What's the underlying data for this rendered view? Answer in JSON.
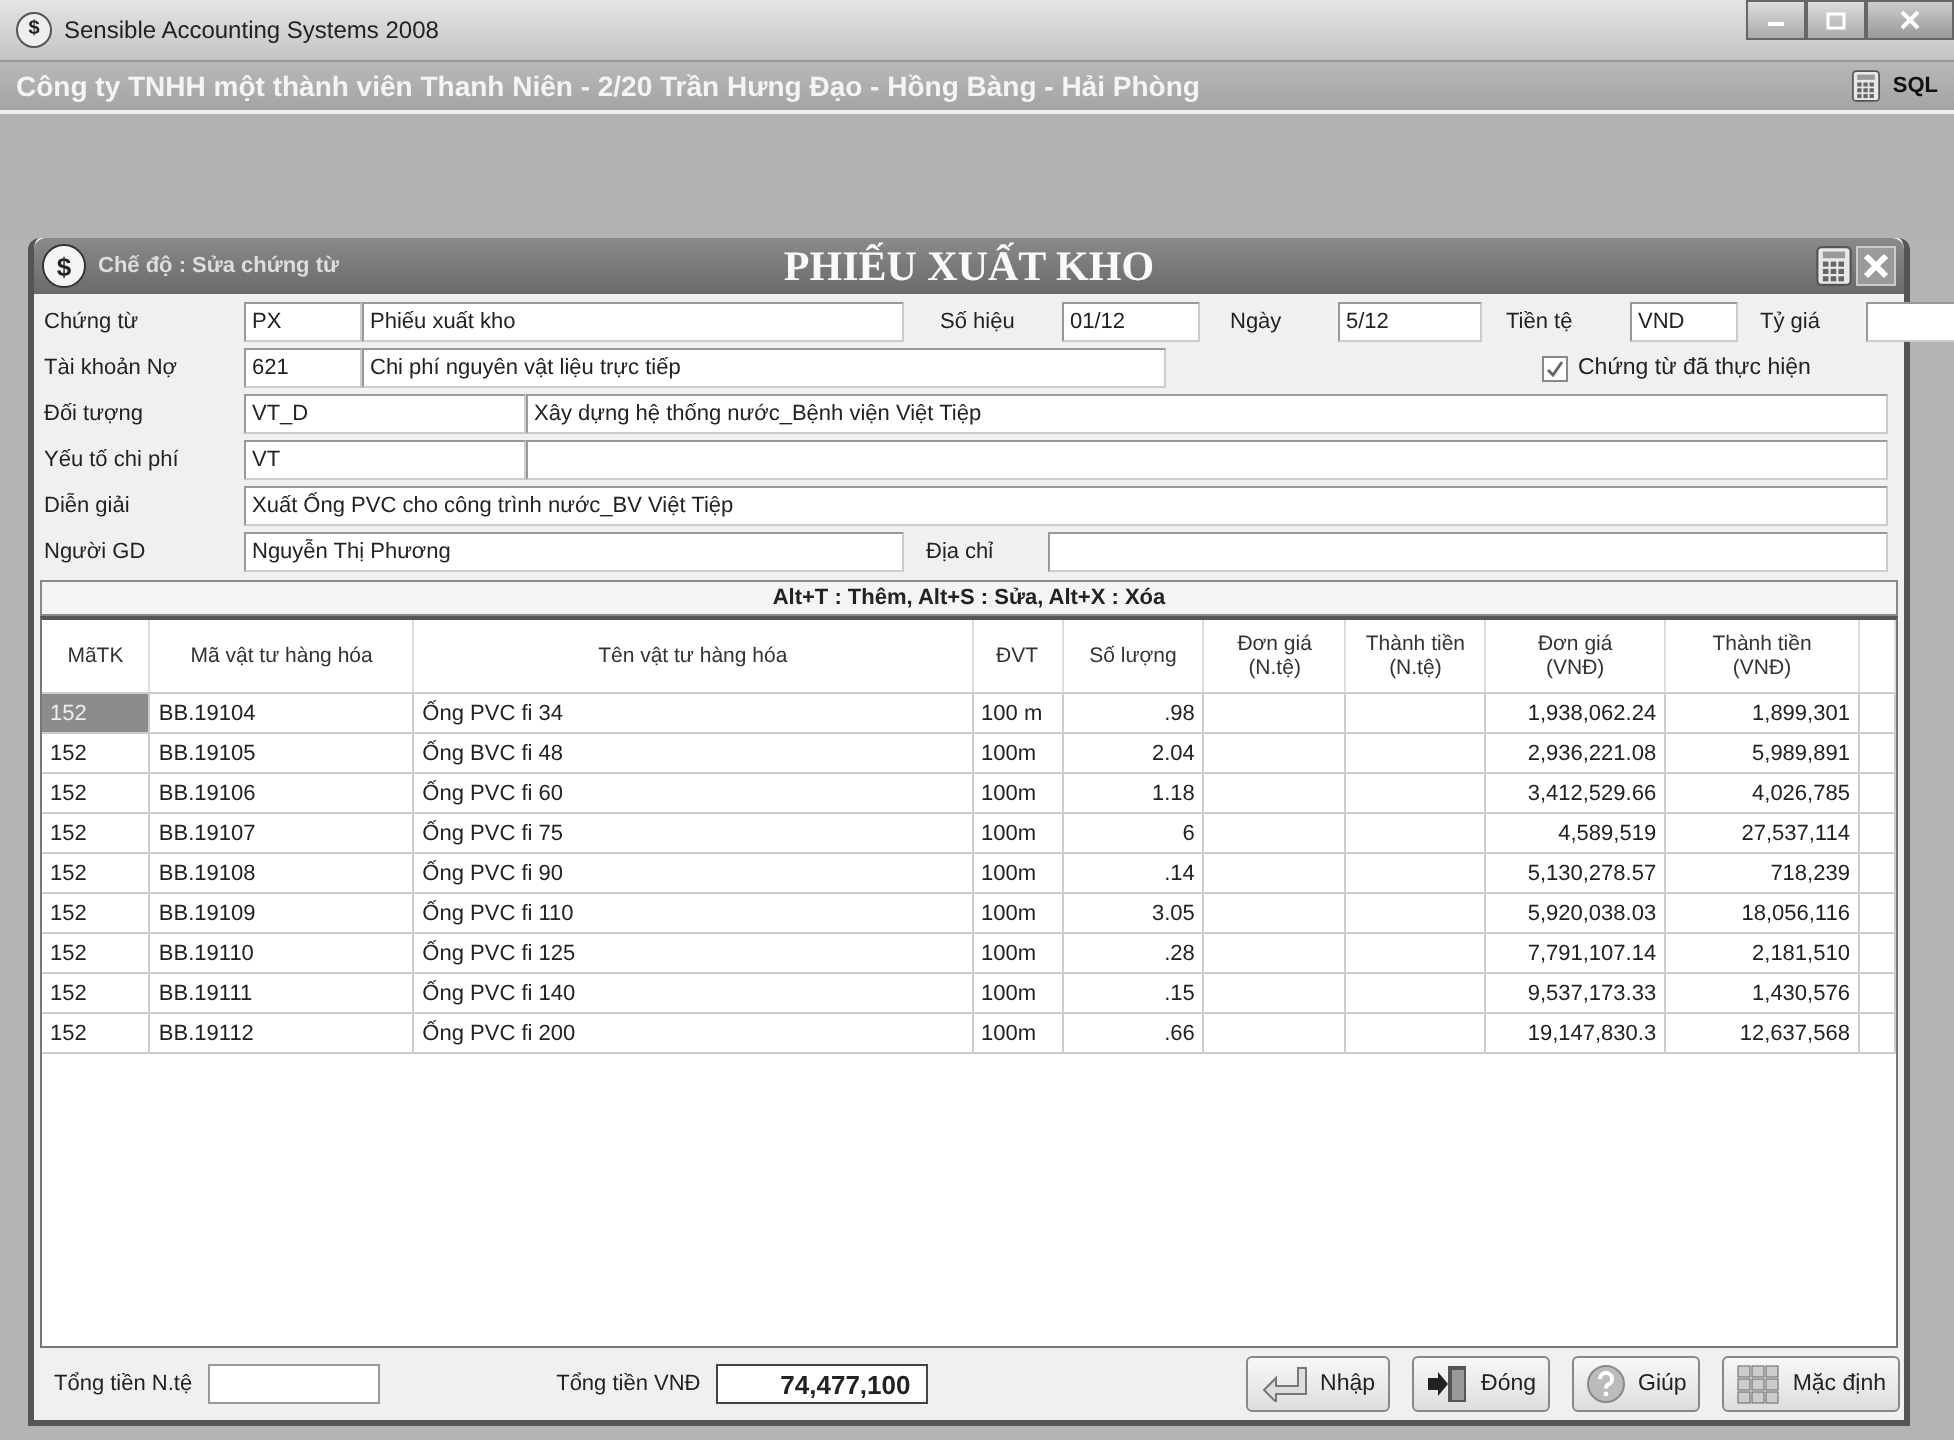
{
  "app": {
    "icon_text": "$",
    "title": "Sensible Accounting Systems 2008",
    "company": "Công ty TNHH một thành viên Thanh Niên - 2/20 Trần Hưng Đạo - Hồng Bàng - Hải Phòng",
    "db_label": "SQL"
  },
  "dialog": {
    "icon_text": "$",
    "mode": "Chế độ : Sửa chứng từ",
    "title": "PHIẾU XUẤT KHO"
  },
  "form": {
    "document": {
      "label": "Chứng từ",
      "code": "PX",
      "name": "Phiếu xuất kho"
    },
    "number": {
      "label": "Số hiệu",
      "value": "01/12"
    },
    "date": {
      "label": "Ngày",
      "value": "5/12"
    },
    "currency": {
      "label": "Tiền tệ",
      "value": "VND"
    },
    "rate": {
      "label": "Tỷ giá"
    },
    "debit_account": {
      "label": "Tài khoản Nợ",
      "code": "621",
      "name": "Chi phí nguyên vật liệu trực tiếp"
    },
    "done": {
      "label": "Chứng từ đã thực hiện",
      "checked": true
    },
    "subject": {
      "label": "Đối tượng",
      "code": "VT_D",
      "name": "Xây dựng hệ thống nước_Bệnh viện Việt Tiệp"
    },
    "cost_element": {
      "label": "Yếu tố chi phí",
      "code": "VT"
    },
    "description": {
      "label": "Diễn giải",
      "value": "Xuất Ống PVC cho công trình nước_BV Việt Tiệp"
    },
    "person": {
      "label": "Người GD",
      "value": "Nguyễn Thị Phương"
    },
    "address": {
      "label": "Địa chỉ"
    }
  },
  "hint": "Alt+T : Thêm,  Alt+S : Sửa,  Alt+X : Xóa",
  "table": {
    "columns": [
      "MãTK",
      "Mã vật tư hàng hóa",
      "Tên vật tư hàng hóa",
      "ĐVT",
      "Số lượng",
      "Đơn giá\n(N.tệ)",
      "Thành tiền\n(N.tệ)",
      "Đơn giá\n(VNĐ)",
      "Thành tiền\n(VNĐ)"
    ],
    "rows": [
      {
        "selected": true,
        "cells": [
          "152",
          "BB.19104",
          "Ống PVC fi 34",
          "100 m",
          ".98",
          "",
          "",
          "1,938,062.24",
          "1,899,301"
        ]
      },
      {
        "selected": false,
        "cells": [
          "152",
          "BB.19105",
          "Ống BVC fi 48",
          "100m",
          "2.04",
          "",
          "",
          "2,936,221.08",
          "5,989,891"
        ]
      },
      {
        "selected": false,
        "cells": [
          "152",
          "BB.19106",
          "Ống PVC fi 60",
          "100m",
          "1.18",
          "",
          "",
          "3,412,529.66",
          "4,026,785"
        ]
      },
      {
        "selected": false,
        "cells": [
          "152",
          "BB.19107",
          "Ống PVC fi 75",
          "100m",
          "6",
          "",
          "",
          "4,589,519",
          "27,537,114"
        ]
      },
      {
        "selected": false,
        "cells": [
          "152",
          "BB.19108",
          "Ống PVC fi 90",
          "100m",
          ".14",
          "",
          "",
          "5,130,278.57",
          "718,239"
        ]
      },
      {
        "selected": false,
        "cells": [
          "152",
          "BB.19109",
          "Ống PVC fi 110",
          "100m",
          "3.05",
          "",
          "",
          "5,920,038.03",
          "18,056,116"
        ]
      },
      {
        "selected": false,
        "cells": [
          "152",
          "BB.19110",
          "Ống PVC fi 125",
          "100m",
          ".28",
          "",
          "",
          "7,791,107.14",
          "2,181,510"
        ]
      },
      {
        "selected": false,
        "cells": [
          "152",
          "BB.19111",
          "Ống PVC fi 140",
          "100m",
          ".15",
          "",
          "",
          "9,537,173.33",
          "1,430,576"
        ]
      },
      {
        "selected": false,
        "cells": [
          "152",
          "BB.19112",
          "Ống PVC fi 200",
          "100m",
          ".66",
          "",
          "",
          "19,147,830.3",
          "12,637,568"
        ]
      }
    ]
  },
  "footer": {
    "total_foreign_label": "Tổng tiền N.tệ",
    "total_vnd_label": "Tổng tiền VNĐ",
    "total_vnd": "74,477,100",
    "buttons": [
      {
        "kind": "import",
        "label": "Nhập"
      },
      {
        "kind": "close",
        "label": "Đóng"
      },
      {
        "kind": "help",
        "label": "Giúp"
      },
      {
        "kind": "default",
        "label": "Mặc định"
      }
    ]
  }
}
